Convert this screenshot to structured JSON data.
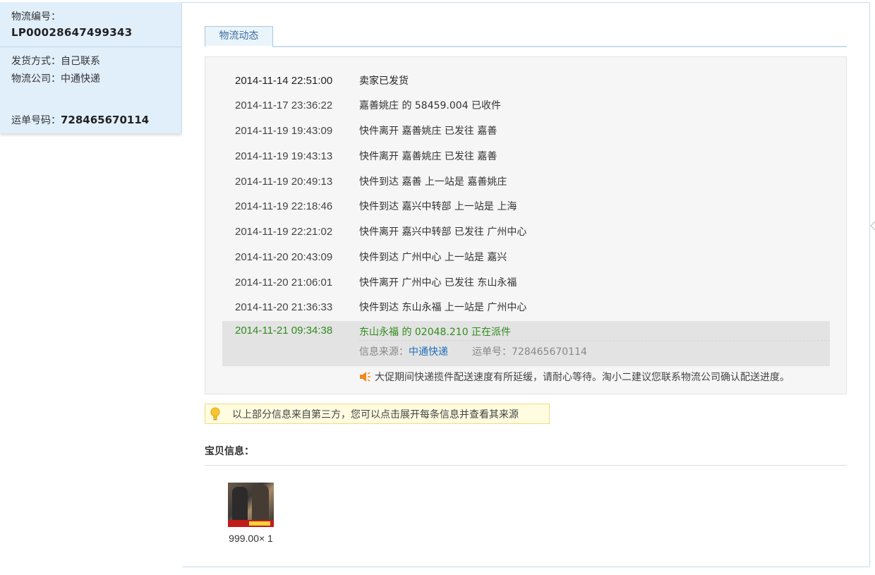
{
  "sidebar": {
    "logistics_no_label": "物流编号：",
    "logistics_no": "LP00028647499343",
    "ship_method_label": "发货方式：",
    "ship_method": "自己联系",
    "company_label": "物流公司：",
    "company": "中通快递",
    "waybill_label": "运单号码：",
    "waybill_no": "728465670114"
  },
  "tabs": [
    {
      "label": "物流动态"
    }
  ],
  "log": [
    {
      "time": "2014-11-14 22:51:00",
      "desc": "卖家已发货"
    },
    {
      "time": "2014-11-17 23:36:22",
      "desc": "嘉善姚庄 的 58459.004 已收件"
    },
    {
      "time": "2014-11-19 19:43:09",
      "desc": "快件离开 嘉善姚庄 已发往 嘉善"
    },
    {
      "time": "2014-11-19 19:43:13",
      "desc": "快件离开 嘉善姚庄 已发往 嘉善"
    },
    {
      "time": "2014-11-19 20:49:13",
      "desc": "快件到达 嘉善 上一站是 嘉善姚庄"
    },
    {
      "time": "2014-11-19 22:18:46",
      "desc": "快件到达 嘉兴中转部 上一站是 上海"
    },
    {
      "time": "2014-11-19 22:21:02",
      "desc": "快件离开 嘉兴中转部 已发往 广州中心"
    },
    {
      "time": "2014-11-20 20:43:09",
      "desc": "快件到达 广州中心 上一站是 嘉兴"
    },
    {
      "time": "2014-11-20 21:06:01",
      "desc": "快件离开 广州中心 已发往 东山永福"
    },
    {
      "time": "2014-11-20 21:36:33",
      "desc": "快件到达 东山永福 上一站是 广州中心"
    }
  ],
  "current": {
    "time": "2014-11-21 09:34:38",
    "desc": "东山永福 的 02048.210 正在派件",
    "source_label": "信息来源：",
    "source_name": "中通快递",
    "waybill_text": "运单号：728465670114"
  },
  "notice": "大促期间快递揽件配送速度有所延缓，请耐心等待。淘小二建议您联系物流公司确认配送进度。",
  "tip": "以上部分信息来自第三方，您可以点击展开每条信息并查看其来源",
  "section_title": "宝贝信息：",
  "item": {
    "price": "999.00× 1"
  },
  "colors": {
    "sidebar_bg": "#e1effb",
    "current_green": "#2f8c1c",
    "link_blue": "#1f6fb8",
    "tip_bg": "#fffce0"
  }
}
